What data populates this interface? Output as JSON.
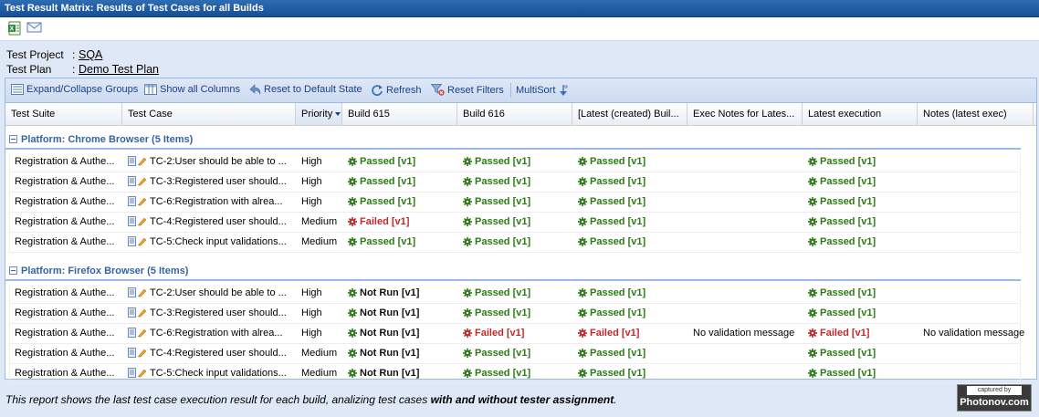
{
  "title": "Test Result Matrix: Results of Test Cases for all Builds",
  "project": {
    "label": "Test Project",
    "value": "SQA"
  },
  "plan": {
    "label": "Test Plan",
    "value": "Demo Test Plan"
  },
  "toolbar": {
    "expand": "Expand/Collapse Groups",
    "show_all": "Show all Columns",
    "reset_state": "Reset to Default State",
    "refresh": "Refresh",
    "reset_filters": "Reset Filters",
    "multisort": "MultiSort"
  },
  "columns": [
    "Test Suite",
    "Test Case",
    "Priority",
    "Build 615",
    "Build 616",
    "[Latest (created) Buil...",
    "Exec Notes for Lates...",
    "Latest execution",
    "Notes (latest exec)"
  ],
  "groups": [
    {
      "title": "Platform: Chrome Browser (5 Items)",
      "rows": [
        {
          "suite": "Registration & Authe...",
          "tc": "TC-2:User should be able to ...",
          "priority": "High",
          "b615": "Passed [v1]",
          "b615_s": "passed",
          "b616": "Passed [v1]",
          "b616_s": "passed",
          "latest_build": "Passed [v1]",
          "latest_build_s": "passed",
          "exec_notes": "",
          "latest_exec": "Passed [v1]",
          "latest_exec_s": "passed",
          "notes": ""
        },
        {
          "suite": "Registration & Authe...",
          "tc": "TC-3:Registered user should...",
          "priority": "High",
          "b615": "Passed [v1]",
          "b615_s": "passed",
          "b616": "Passed [v1]",
          "b616_s": "passed",
          "latest_build": "Passed [v1]",
          "latest_build_s": "passed",
          "exec_notes": "",
          "latest_exec": "Passed [v1]",
          "latest_exec_s": "passed",
          "notes": ""
        },
        {
          "suite": "Registration & Authe...",
          "tc": "TC-6:Registration with alrea...",
          "priority": "High",
          "b615": "Passed [v1]",
          "b615_s": "passed",
          "b616": "Passed [v1]",
          "b616_s": "passed",
          "latest_build": "Passed [v1]",
          "latest_build_s": "passed",
          "exec_notes": "",
          "latest_exec": "Passed [v1]",
          "latest_exec_s": "passed",
          "notes": ""
        },
        {
          "suite": "Registration & Authe...",
          "tc": "TC-4:Registered user should...",
          "priority": "Medium",
          "b615": "Failed [v1]",
          "b615_s": "failed",
          "b616": "Passed [v1]",
          "b616_s": "passed",
          "latest_build": "Passed [v1]",
          "latest_build_s": "passed",
          "exec_notes": "",
          "latest_exec": "Passed [v1]",
          "latest_exec_s": "passed",
          "notes": ""
        },
        {
          "suite": "Registration & Authe...",
          "tc": "TC-5:Check input validations...",
          "priority": "Medium",
          "b615": "Passed [v1]",
          "b615_s": "passed",
          "b616": "Passed [v1]",
          "b616_s": "passed",
          "latest_build": "Passed [v1]",
          "latest_build_s": "passed",
          "exec_notes": "",
          "latest_exec": "Passed [v1]",
          "latest_exec_s": "passed",
          "notes": ""
        }
      ]
    },
    {
      "title": "Platform: Firefox Browser (5 Items)",
      "rows": [
        {
          "suite": "Registration & Authe...",
          "tc": "TC-2:User should be able to ...",
          "priority": "High",
          "b615": "Not Run [v1]",
          "b615_s": "notrun",
          "b616": "Passed [v1]",
          "b616_s": "passed",
          "latest_build": "Passed [v1]",
          "latest_build_s": "passed",
          "exec_notes": "",
          "latest_exec": "Passed [v1]",
          "latest_exec_s": "passed",
          "notes": ""
        },
        {
          "suite": "Registration & Authe...",
          "tc": "TC-3:Registered user should...",
          "priority": "High",
          "b615": "Not Run [v1]",
          "b615_s": "notrun",
          "b616": "Passed [v1]",
          "b616_s": "passed",
          "latest_build": "Passed [v1]",
          "latest_build_s": "passed",
          "exec_notes": "",
          "latest_exec": "Passed [v1]",
          "latest_exec_s": "passed",
          "notes": ""
        },
        {
          "suite": "Registration & Authe...",
          "tc": "TC-6:Registration with alrea...",
          "priority": "High",
          "b615": "Not Run [v1]",
          "b615_s": "notrun",
          "b616": "Failed [v1]",
          "b616_s": "failed",
          "latest_build": "Failed [v1]",
          "latest_build_s": "failed",
          "exec_notes": "No validation message",
          "latest_exec": "Failed [v1]",
          "latest_exec_s": "failed",
          "notes": "No validation message"
        },
        {
          "suite": "Registration & Authe...",
          "tc": "TC-4:Registered user should...",
          "priority": "Medium",
          "b615": "Not Run [v1]",
          "b615_s": "notrun",
          "b616": "Passed [v1]",
          "b616_s": "passed",
          "latest_build": "Passed [v1]",
          "latest_build_s": "passed",
          "exec_notes": "",
          "latest_exec": "Passed [v1]",
          "latest_exec_s": "passed",
          "notes": ""
        },
        {
          "suite": "Registration & Authe...",
          "tc": "TC-5:Check input validations...",
          "priority": "Medium",
          "b615": "Not Run [v1]",
          "b615_s": "notrun",
          "b616": "Passed [v1]",
          "b616_s": "passed",
          "latest_build": "Passed [v1]",
          "latest_build_s": "passed",
          "exec_notes": "",
          "latest_exec": "Passed [v1]",
          "latest_exec_s": "passed",
          "notes": ""
        }
      ]
    }
  ],
  "footer": {
    "text_before": "This report shows the last test case execution result for each build, analizing test cases ",
    "text_bold": "with and without tester assignment",
    "text_after": "."
  },
  "badge": {
    "caption": "captured by",
    "brand": "Photonov.com"
  },
  "icons": {
    "export": "excel-export-icon",
    "email": "email-icon",
    "gear": "gear-status-icon",
    "edit": "edit-pencil-icon",
    "doc": "document-icon"
  }
}
